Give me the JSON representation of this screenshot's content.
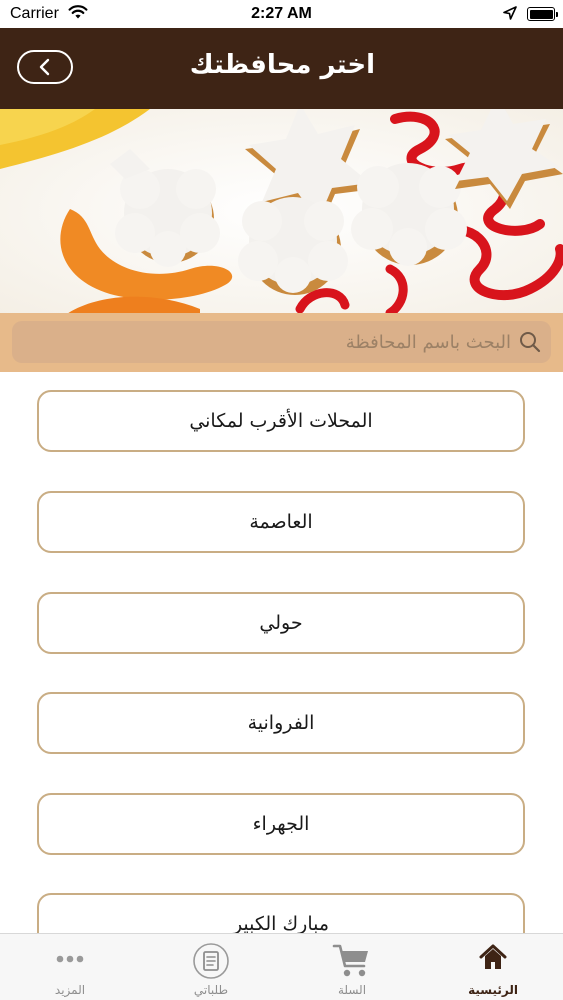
{
  "status_bar": {
    "carrier": "Carrier",
    "time": "2:27 AM"
  },
  "header": {
    "title": "اختر محافظتك",
    "back_icon": "chevron-left-icon"
  },
  "banner": {
    "image_icon": "cookies-image",
    "slide_count": 4,
    "active_slide": 4
  },
  "search": {
    "placeholder": "البحث باسم المحافظة",
    "icon": "search-icon"
  },
  "governorates": [
    "المحلات الأقرب لمكاني",
    "العاصمة",
    "حولي",
    "الفروانية",
    "الجهراء",
    "مبارك الكبير"
  ],
  "tab_bar": {
    "tabs": [
      {
        "label": "الرئيسية",
        "icon": "home-icon",
        "active": true
      },
      {
        "label": "السلة",
        "icon": "cart-icon",
        "active": false
      },
      {
        "label": "طلباتي",
        "icon": "orders-icon",
        "active": false
      },
      {
        "label": "المزيد",
        "icon": "more-icon",
        "active": false
      }
    ]
  },
  "colors": {
    "header_bg": "#3e2415",
    "search_bar_bg": "#e7ba8a",
    "item_border": "#c9ad84"
  }
}
